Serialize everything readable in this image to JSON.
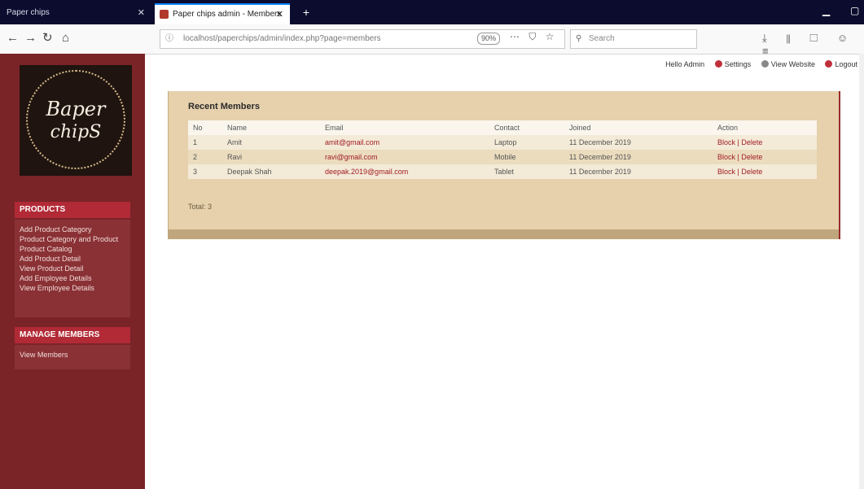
{
  "browser": {
    "inactive_tab": "Paper chips",
    "active_tab": "Paper chips admin - Members",
    "url": "localhost/paperchips/admin/index.php?page=members",
    "zoom": "90%",
    "search_placeholder": "Search"
  },
  "sidebar": {
    "logo_line1": "Baper",
    "logo_line2": "chipS",
    "sections": [
      {
        "heading": "PRODUCTS",
        "items": [
          "Add Product Category",
          "Product Category and Product",
          "Product Catalog",
          "Add Product Detail",
          "View Product Detail",
          "Add Employee Details",
          "View Employee Details"
        ]
      },
      {
        "heading": "MANAGE MEMBERS",
        "items": [
          "View Members"
        ]
      }
    ]
  },
  "toplinks": {
    "greeting": "Hello Admin",
    "settings": "Settings",
    "view_website": "View Website",
    "logout": "Logout"
  },
  "main": {
    "title": "Recent Members",
    "columns": [
      "No",
      "Name",
      "Email",
      "Contact",
      "Joined",
      "Action"
    ],
    "rows": [
      {
        "no": "1",
        "name": "Amit",
        "email": "amit@gmail.com",
        "contact": "Laptop",
        "joined": "11 December 2019",
        "action": "Block | Delete"
      },
      {
        "no": "2",
        "name": "Ravi",
        "email": "ravi@gmail.com",
        "contact": "Mobile",
        "joined": "11 December 2019",
        "action": "Block | Delete"
      },
      {
        "no": "3",
        "name": "Deepak Shah",
        "email": "deepak.2019@gmail.com",
        "contact": "Tablet",
        "joined": "11 December 2019",
        "action": "Block | Delete"
      }
    ],
    "footer_note": "Total: 3"
  }
}
